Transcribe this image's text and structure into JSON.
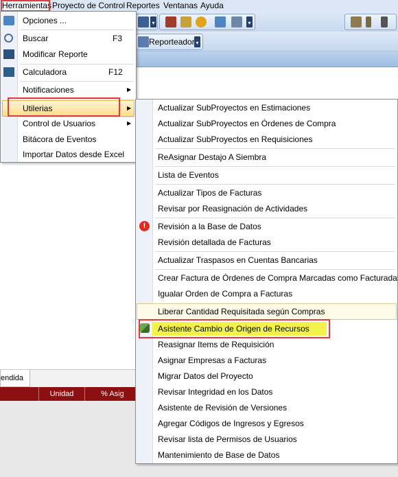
{
  "menubar": {
    "items": [
      "Herramientas",
      "Proyecto de Control",
      "Reportes",
      "Ventanas",
      "Ayuda"
    ]
  },
  "toolbar": {
    "reporteador_label": "Reporteador"
  },
  "tabs": {
    "active_fragment": "endida"
  },
  "grid": {
    "columns": [
      "Unidad",
      "% Asig"
    ]
  },
  "herramientas_menu": {
    "items": [
      {
        "label": "Opciones ...",
        "shortcut": "",
        "icon": "options-icon"
      },
      {
        "label": "Buscar",
        "shortcut": "F3",
        "icon": "search-icon"
      },
      {
        "label": "Modificar Reporte",
        "shortcut": "",
        "icon": "report-icon"
      },
      {
        "label": "Calculadora",
        "shortcut": "F12",
        "icon": "calculator-icon"
      },
      {
        "label": "Notificaciones",
        "shortcut": "",
        "submenu": true
      },
      {
        "label": "Utilerias",
        "shortcut": "",
        "submenu": true,
        "highlighted": true
      },
      {
        "label": "Control de Usuarios",
        "shortcut": "",
        "submenu": true
      },
      {
        "label": "Bitácora de Eventos",
        "shortcut": ""
      },
      {
        "label": "Importar Datos desde Excel",
        "shortcut": ""
      }
    ]
  },
  "utilerias_menu": {
    "items": [
      "Actualizar SubProyectos en Estimaciones",
      "Actualizar SubProyectos en Órdenes de Compra",
      "Actualizar SubProyectos en Requisiciones",
      "ReAsignar Destajo A Siembra",
      "Lista de Eventos",
      "Actualizar Tipos de Facturas",
      "Revisar por Reasignación de Actividades",
      "Revisión a la Base de Datos",
      "Revisión detallada de Facturas",
      "Actualizar Traspasos en Cuentas Bancarias",
      "Crear Factura de Órdenes de Compra Marcadas como Facturadas",
      "Igualar Orden de Compra a Facturas",
      "Liberar Cantidad Requisitada según Compras",
      "Asistente Cambio de Origen de Recursos",
      "Reasignar Items de Requisición",
      "Asignar Empresas a Facturas",
      "Migrar Datos del Proyecto",
      "Revisar Integridad en los Datos",
      "Asistente de Revisión de Versiones",
      "Agregar Códigos de Ingresos y Egresos",
      "Revisar lista de Permisos de Usuarios",
      "Mantenimiento de Base de Datos"
    ]
  },
  "colors": {
    "highlight_border": "#e23b3b",
    "grid_header": "#8c1012",
    "menu_hover": "#ffdc8a",
    "yellow_highlight": "#f2f24a"
  }
}
